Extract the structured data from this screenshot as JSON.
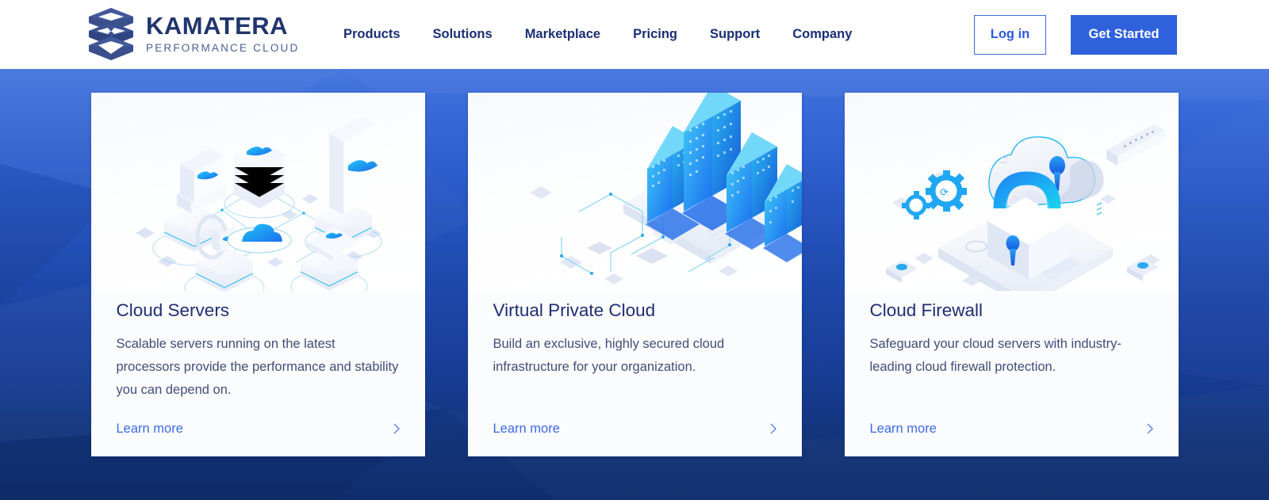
{
  "brand": {
    "logo_icon": "kamatera-stacked-hex-logo",
    "wordmark": "KAMATERA",
    "tagline": "PERFORMANCE CLOUD",
    "wordmark_color": "#20356e",
    "tagline_color": "#4a6195"
  },
  "nav": {
    "items": [
      {
        "label": "Products"
      },
      {
        "label": "Solutions"
      },
      {
        "label": "Marketplace"
      },
      {
        "label": "Pricing"
      },
      {
        "label": "Support"
      },
      {
        "label": "Company"
      }
    ]
  },
  "header_actions": {
    "login_label": "Log in",
    "get_started_label": "Get Started",
    "login_color": "#2b5ce0",
    "get_started_bg": "#2f61dd"
  },
  "hero": {
    "background_top_color": "#4577e0",
    "background_bottom_color": "#102e6d"
  },
  "cards": [
    {
      "title": "Cloud Servers",
      "description": "Scalable servers running on the latest processors provide the performance and stability you can depend on.",
      "link_label": "Learn more",
      "illustration": "cloud-servers-isometric-illustration",
      "link_color": "#3a6ae4"
    },
    {
      "title": "Virtual Private Cloud",
      "description": "Build an exclusive, highly secured cloud infrastructure for your organization.",
      "link_label": "Learn more",
      "illustration": "virtual-private-cloud-isometric-illustration",
      "link_color": "#3a6ae4"
    },
    {
      "title": "Cloud Firewall",
      "description": "Safeguard your cloud servers with industry-leading cloud firewall protection.",
      "link_label": "Learn more",
      "illustration": "cloud-firewall-padlock-isometric-illustration",
      "link_color": "#3a6ae4"
    }
  ]
}
